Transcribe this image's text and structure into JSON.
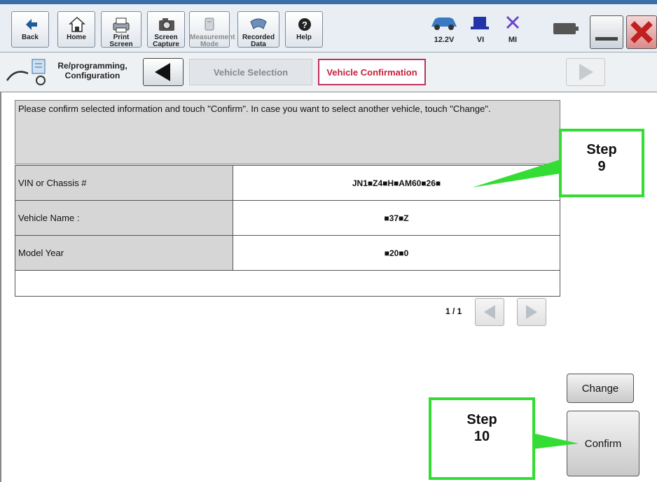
{
  "toolbar": {
    "back_label": "Back",
    "home_label": "Home",
    "print_label": "Print Screen",
    "capture_label": "Screen Capture",
    "measurement_label": "Measurement Mode",
    "recorded_label": "Recorded Data",
    "help_label": "Help",
    "voltage": "12.2V",
    "vi_label": "VI",
    "mi_label": "MI"
  },
  "nav": {
    "section_label": "Re/programming, Configuration",
    "crumb_1": "Vehicle Selection",
    "crumb_2": "Vehicle Confirmation"
  },
  "message": "Please confirm selected information and touch \"Confirm\". In case you want to select another vehicle, touch \"Change\".",
  "vehicle_table": {
    "rows": [
      {
        "label": "VIN or Chassis #",
        "value": "JN1■Z4■H■AM60■26■"
      },
      {
        "label": "Vehicle Name :",
        "value": "■37■Z"
      },
      {
        "label": "Model Year",
        "value": "■20■0"
      }
    ]
  },
  "pager": {
    "text": "1 / 1"
  },
  "buttons": {
    "change": "Change",
    "confirm": "Confirm"
  },
  "annotations": {
    "step9": {
      "line1": "Step",
      "line2": "9"
    },
    "step10": {
      "line1": "Step",
      "line2": "10"
    },
    "color": "#33dd33"
  }
}
